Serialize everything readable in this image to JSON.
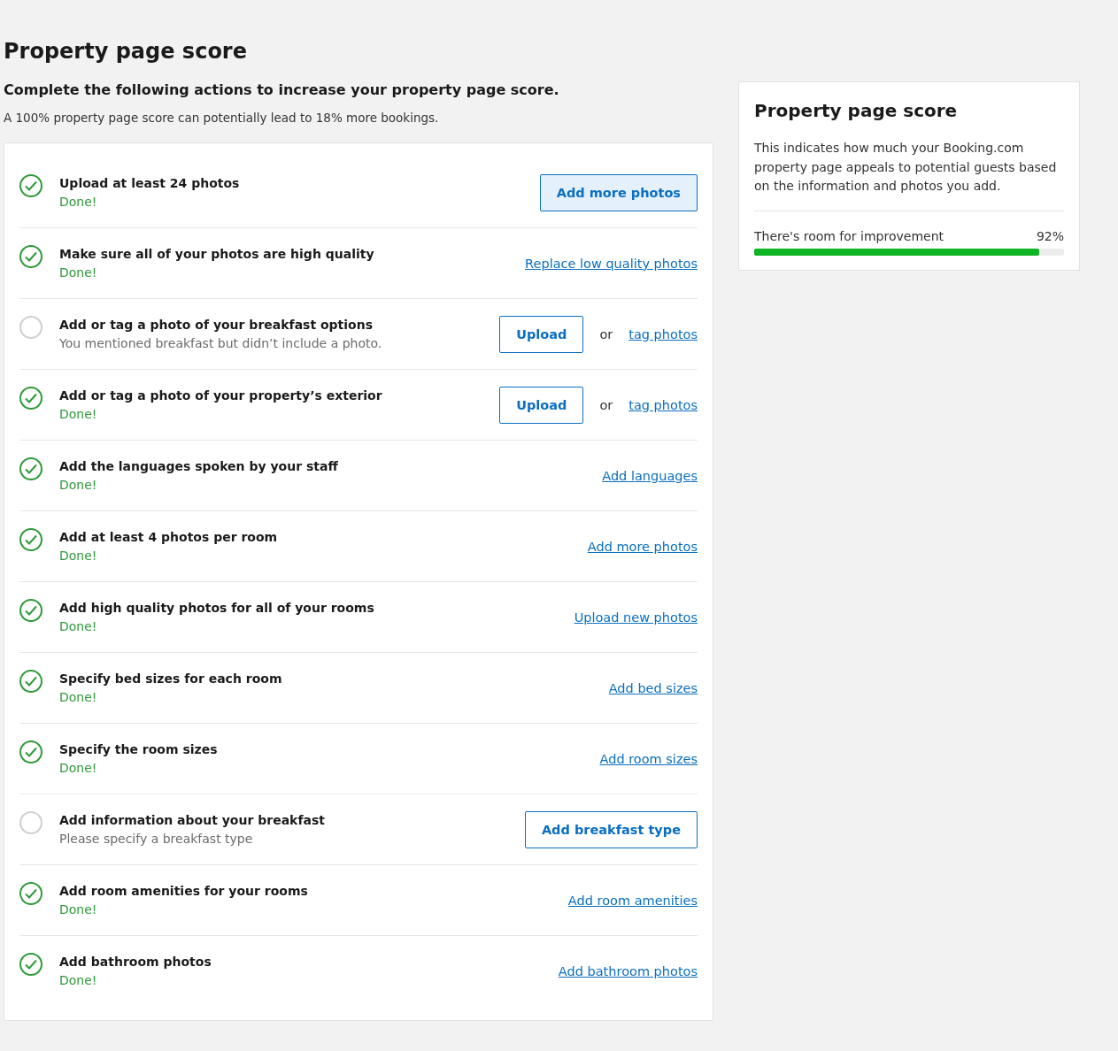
{
  "page": {
    "title": "Property page score",
    "subtitle": "Complete the following actions to increase your property page score.",
    "note": "A 100% property page score can potentially lead to 18% more bookings."
  },
  "tasks": [
    {
      "title": "Upload at least 24 photos",
      "status": "Done!",
      "done": true,
      "actions": [
        {
          "kind": "primary",
          "label": "Add more photos"
        }
      ]
    },
    {
      "title": "Make sure all of your photos are high quality",
      "status": "Done!",
      "done": true,
      "actions": [
        {
          "kind": "link",
          "label": "Replace low quality photos"
        }
      ]
    },
    {
      "title": "Add or tag a photo of your breakfast options",
      "status": "You mentioned breakfast but didn’t include a photo.",
      "done": false,
      "actions": [
        {
          "kind": "secondary",
          "label": "Upload"
        },
        {
          "kind": "or",
          "label": "or"
        },
        {
          "kind": "link",
          "label": "tag photos"
        }
      ]
    },
    {
      "title": "Add or tag a photo of your property’s exterior",
      "status": "Done!",
      "done": true,
      "actions": [
        {
          "kind": "secondary",
          "label": "Upload"
        },
        {
          "kind": "or",
          "label": "or"
        },
        {
          "kind": "link",
          "label": "tag photos"
        }
      ]
    },
    {
      "title": "Add the languages spoken by your staff",
      "status": "Done!",
      "done": true,
      "actions": [
        {
          "kind": "link",
          "label": "Add languages"
        }
      ]
    },
    {
      "title": "Add at least 4 photos per room",
      "status": "Done!",
      "done": true,
      "actions": [
        {
          "kind": "link",
          "label": "Add more photos"
        }
      ]
    },
    {
      "title": "Add high quality photos for all of your rooms",
      "status": "Done!",
      "done": true,
      "actions": [
        {
          "kind": "link",
          "label": "Upload new photos"
        }
      ]
    },
    {
      "title": "Specify bed sizes for each room",
      "status": "Done!",
      "done": true,
      "actions": [
        {
          "kind": "link",
          "label": "Add bed sizes"
        }
      ]
    },
    {
      "title": "Specify the room sizes",
      "status": "Done!",
      "done": true,
      "actions": [
        {
          "kind": "link",
          "label": "Add room sizes"
        }
      ]
    },
    {
      "title": "Add information about your breakfast",
      "status": "Please specify a breakfast type",
      "done": false,
      "actions": [
        {
          "kind": "secondary",
          "label": "Add breakfast type"
        }
      ]
    },
    {
      "title": "Add room amenities for your rooms",
      "status": "Done!",
      "done": true,
      "actions": [
        {
          "kind": "link",
          "label": "Add room amenities"
        }
      ]
    },
    {
      "title": "Add bathroom photos",
      "status": "Done!",
      "done": true,
      "actions": [
        {
          "kind": "link",
          "label": "Add bathroom photos"
        }
      ]
    }
  ],
  "score_card": {
    "title": "Property page score",
    "description": "This indicates how much your Booking.com property page appeals to potential guests based on the information and photos you add.",
    "label": "There's room for improvement",
    "reading": "92%",
    "level": 0.92
  }
}
